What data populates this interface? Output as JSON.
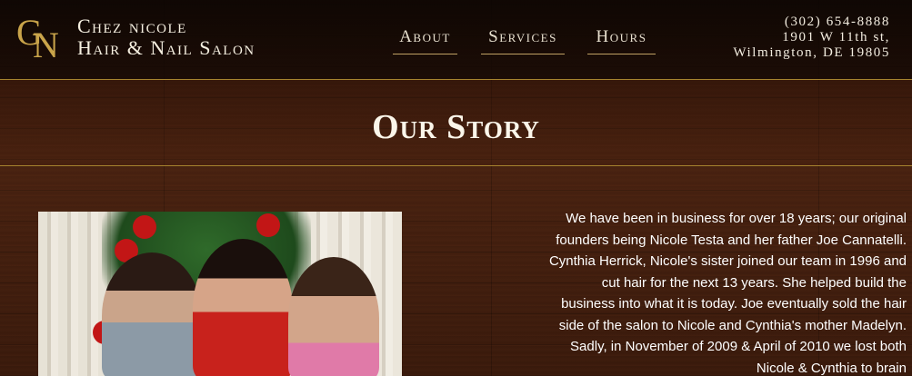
{
  "header": {
    "logo_letters": [
      "G",
      "N"
    ],
    "brand_line1": "Chez nicole",
    "brand_line2": "Hair & Nail Salon",
    "nav": [
      {
        "label": "About"
      },
      {
        "label": "Services"
      },
      {
        "label": "Hours"
      }
    ],
    "contact": {
      "phone": "(302) 654-8888",
      "address1": "1901 W 11th st,",
      "address2": "Wilmington, DE 19805"
    }
  },
  "main": {
    "title": "Our Story",
    "story_text": "We have been in business for over 18 years; our original founders being Nicole Testa and her father Joe Cannatelli. Cynthia Herrick, Nicole's sister joined our team in 1996 and cut hair for the next 13 years. She helped build the business into what it is today. Joe eventually sold the hair side of the salon to Nicole and Cynthia's mother Madelyn. Sadly, in November of 2009 & April of 2010 we lost both Nicole & Cynthia to brain"
  },
  "colors": {
    "gold_accent": "#a7842f",
    "logo_gold": "#c9a44a",
    "text_light": "#f5efe0"
  }
}
